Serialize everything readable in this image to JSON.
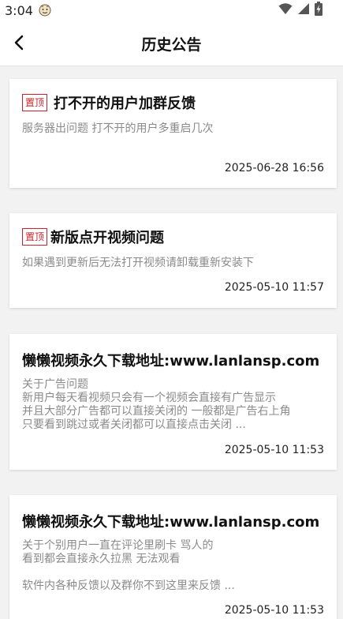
{
  "status_bar": {
    "time": "3:04",
    "emoji_icon": "cartoon-face-icon",
    "icons": [
      "wifi-icon",
      "signal-icon",
      "battery-charging-icon"
    ]
  },
  "nav": {
    "title": "历史公告",
    "back_icon": "chevron-left-icon"
  },
  "notices": [
    {
      "pinned": true,
      "badge": "置顶",
      "title": "打不开的用户加群反馈",
      "body": "服务器出问题 打不开的用户多重启几次",
      "time": "2025-06-28 16:56"
    },
    {
      "pinned": true,
      "badge": "置顶",
      "title": "新版点开视频问题",
      "body": "如果遇到更新后无法打开视频请卸载重新安装下",
      "time": "2025-05-10 11:57"
    },
    {
      "pinned": false,
      "title": "懒懒视频永久下载地址:www.lanlansp.com",
      "body": "关于广告问题\n新用户每天看视频只会有一个视频会直接有广告显示\n并且大部分广告都可以直接关闭的 一般都是广告右上角\n只要看到跳过或者关闭都可以直接点击关闭 ...",
      "time": "2025-05-10 11:53"
    },
    {
      "pinned": false,
      "title": "懒懒视频永久下载地址:www.lanlansp.com",
      "body": "关于个别用户一直在评论里刷卡 骂人的\n看到都会直接永久拉黑 无法观看\n\n软件内各种反馈以及群你不到这里来反馈 ...",
      "time": "2025-05-10 11:53"
    }
  ]
}
